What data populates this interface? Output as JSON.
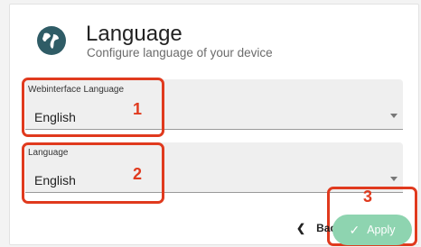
{
  "header": {
    "title": "Language",
    "subtitle": "Configure language of your device"
  },
  "webinterface_language": {
    "label": "Webinterface Language",
    "value": "English"
  },
  "device_language": {
    "label": "Language",
    "value": "English"
  },
  "annotations": [
    "1",
    "2",
    "3"
  ],
  "actions": {
    "back_label": "Back",
    "apply_label": "Apply"
  },
  "colors": {
    "accent": "#8ed4b0",
    "highlight": "#e03a1e",
    "globe": "#2f5c66"
  },
  "icons": {
    "header": "globe-icon",
    "back": "chevron-left-icon",
    "apply": "check-icon",
    "dropdown": "caret-down-icon"
  }
}
